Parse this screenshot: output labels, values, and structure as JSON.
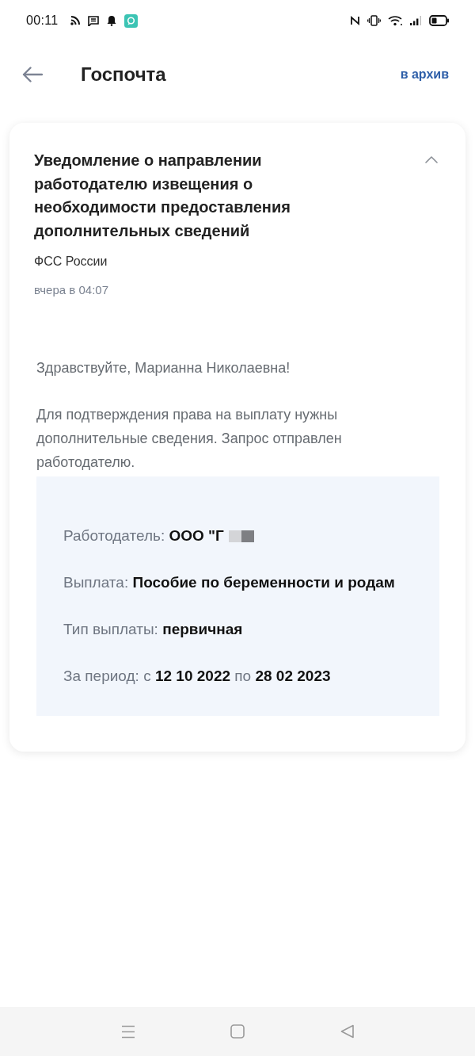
{
  "status_bar": {
    "time": "00:11"
  },
  "header": {
    "title": "Госпочта",
    "archive_link": "в архив"
  },
  "message": {
    "title": "Уведомление о направлении работодателю извещения о необходимости предоставления дополнительных сведений",
    "expanded": true,
    "sender": "ФСС России",
    "date": "вчера в 04:07",
    "greeting": "Здравствуйте, Марианна Николаевна!",
    "body": "Для подтверждения права на выплату нужны дополнительные сведения. Запрос отправлен работодателю.",
    "details": [
      {
        "text": "Работодатель: **ООО \"Г**",
        "redacted": true
      },
      {
        "text": "Выплата: **Пособие по беременности и родам**",
        "redacted": false
      },
      {
        "text": "Тип выплаты: **первичная**",
        "redacted": false
      },
      {
        "text": "За период: с **12 10 2022** по **28 02 2023**",
        "redacted": false
      }
    ]
  }
}
